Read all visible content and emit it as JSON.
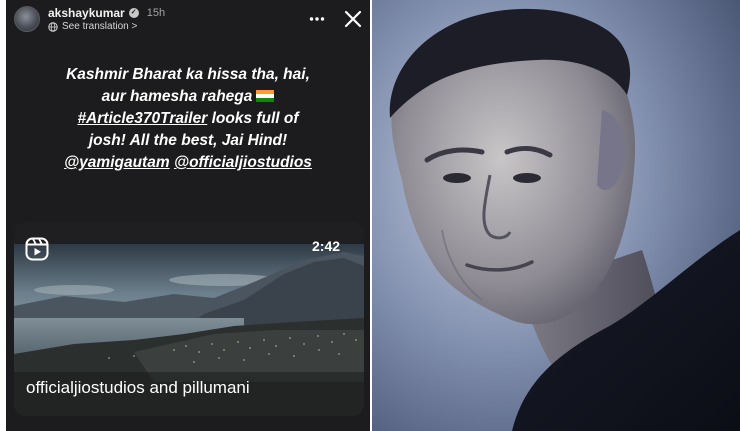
{
  "story": {
    "username": "akshaykumar",
    "time_ago": "15h",
    "see_translation": "See translation >",
    "caption_lines": [
      "Kashmir Bharat ka hissa tha, hai,",
      "aur hamesha rahega"
    ],
    "hashtag": "#Article370Trailer",
    "caption_line3_rest": " looks full of",
    "caption_line4": "josh! All the best, Jai Hind!",
    "mention_1": "@yamigautam",
    "mention_2": "@officialjiostudios",
    "icons": {
      "avatar": "avatar",
      "verified": "verified-badge",
      "more": "more-options-icon",
      "close": "close-icon",
      "flag": "india-flag-emoji",
      "globe": "globe-icon"
    }
  },
  "reel": {
    "duration": "2:42",
    "credit": "officialjiostudios and pillumani",
    "icon": "reels-icon"
  },
  "colors": {
    "story_bg": "#1c1c1e",
    "text": "#ffffff",
    "flag_saffron": "#ff9933",
    "flag_white": "#ffffff",
    "flag_green": "#138808"
  }
}
